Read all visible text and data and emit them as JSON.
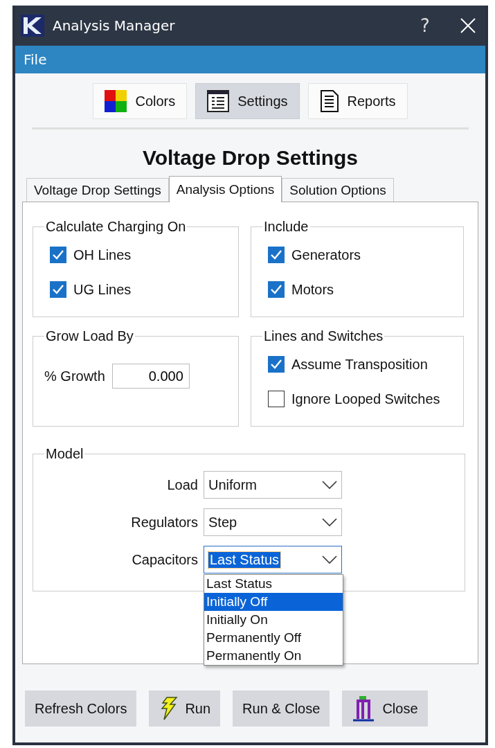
{
  "window": {
    "title": "Analysis Manager",
    "help": "?"
  },
  "menu": [
    "File"
  ],
  "toolbar": [
    {
      "label": "Colors",
      "selected": false
    },
    {
      "label": "Settings",
      "selected": true
    },
    {
      "label": "Reports",
      "selected": false
    }
  ],
  "heading": "Voltage Drop Settings",
  "tabs": [
    {
      "label": "Voltage Drop Settings",
      "selected": false
    },
    {
      "label": "Analysis Options",
      "selected": true
    },
    {
      "label": "Solution Options",
      "selected": false
    }
  ],
  "groups": [
    {
      "kind": "checks",
      "title": "Calculate Charging On",
      "items": [
        {
          "label": "OH Lines",
          "checked": true
        },
        {
          "label": "UG Lines",
          "checked": true
        }
      ]
    },
    {
      "kind": "checks",
      "title": "Include",
      "items": [
        {
          "label": "Generators",
          "checked": true
        },
        {
          "label": "Motors",
          "checked": true
        }
      ]
    },
    {
      "kind": "field",
      "title": "Grow Load By",
      "label": "% Growth",
      "value": "0.000"
    },
    {
      "kind": "checks",
      "title": "Lines and Switches",
      "items": [
        {
          "label": "Assume Transposition",
          "checked": true
        },
        {
          "label": "Ignore Looped Switches",
          "checked": false
        }
      ]
    }
  ],
  "model": {
    "title": "Model",
    "rows": [
      {
        "label": "Load",
        "value": "Uniform",
        "focused": false
      },
      {
        "label": "Regulators",
        "value": "Step",
        "focused": false
      },
      {
        "label": "Capacitors",
        "value": "Last Status",
        "focused": true,
        "options": [
          {
            "label": "Last Status",
            "highlighted": false
          },
          {
            "label": "Initially Off",
            "highlighted": true
          },
          {
            "label": "Initially On",
            "highlighted": false
          },
          {
            "label": "Permanently Off",
            "highlighted": false
          },
          {
            "label": "Permanently On",
            "highlighted": false
          }
        ]
      }
    ]
  },
  "buttons": [
    "Refresh Colors",
    "Run",
    "Run & Close",
    "Close"
  ]
}
